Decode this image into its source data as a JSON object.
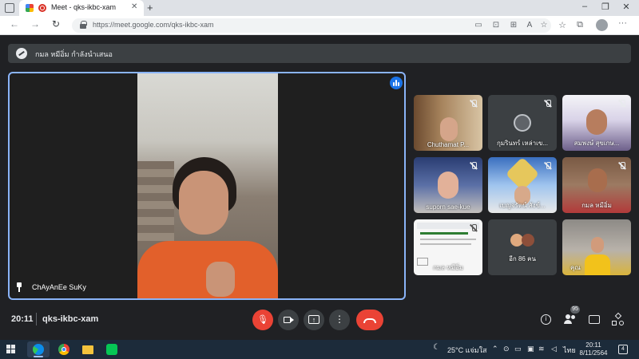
{
  "browser": {
    "tab_title": "Meet - qks-ikbc-xam",
    "tab_close": "✕",
    "new_tab": "+",
    "url": "https://meet.google.com/qks-ikbc-xam",
    "window_controls": {
      "minimize": "–",
      "maximize": "❐",
      "close": "✕"
    },
    "nav": {
      "back": "←",
      "forward": "→",
      "reload": "↻"
    }
  },
  "banner": {
    "text": "กมล หมีอิ่ม กำลังนำเสนอ",
    "icon": "presentation-icon"
  },
  "main_tile": {
    "name": "ChAyAnEe SuKy"
  },
  "participants": [
    {
      "name": "Chuthamat P...",
      "muted": true
    },
    {
      "name": "กุมรินทร์ เหล่าเข...",
      "muted": true
    },
    {
      "name": "สมพงษ์ สุขเกษ...",
      "muted": true
    },
    {
      "name": "suporn sae-kue",
      "muted": true
    },
    {
      "name": "เบญจรัตน์ สังข์...",
      "muted": true
    },
    {
      "name": "กมล หมีอิ่ม",
      "muted": true
    },
    {
      "name": "กมล หมีอิ่ม",
      "muted": true
    },
    {
      "name": "อีก 86 คน",
      "muted": false
    },
    {
      "name": "คุณ",
      "muted": false
    }
  ],
  "bottom_bar": {
    "time": "20:11",
    "separator": "|",
    "meeting_code": "qks-ikbc-xam",
    "people_count": "95"
  },
  "taskbar": {
    "weather": "25°C แจ่มใส",
    "language": "ไทย",
    "time": "20:11",
    "date": "8/11/2564",
    "notifications": "4"
  },
  "colors": {
    "accent": "#8ab4f8",
    "danger": "#ea4335",
    "meet_bg": "#202124"
  }
}
